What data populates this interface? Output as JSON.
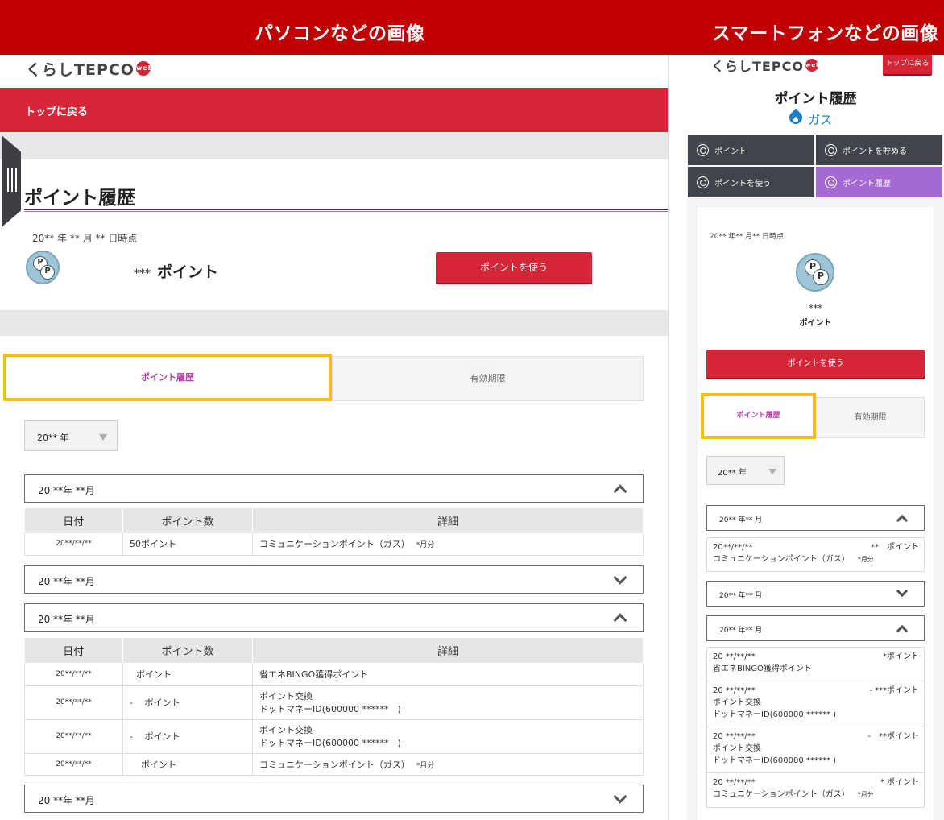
{
  "banner": {
    "pc_label": "パソコンなどの画像",
    "sp_label": "スマートフォンなどの画像"
  },
  "colors": {
    "brand_red": "#d62536",
    "banner_red": "#c00000",
    "accent_purple": "#b43fa8",
    "highlight_yellow": "#f4be1a",
    "menu_dark": "#40444b",
    "menu_active": "#a46ad2"
  },
  "brand": {
    "logo_text": "くらしTEPCO",
    "logo_badge": "web"
  },
  "pc": {
    "back_link": "トップに戻る",
    "page_title": "ポイント履歴",
    "as_of": "20** 年 ** 月 ** 日時点",
    "points_stars": "***",
    "points_label": "ポイント",
    "use_points_button": "ポイントを使う",
    "tabs": {
      "history": "ポイント履歴",
      "expiry": "有効期限"
    },
    "year_select": "20** 年",
    "table_headers": {
      "date": "日付",
      "points": "ポイント数",
      "detail": "詳細"
    },
    "months": [
      {
        "label": "20 **年 **月",
        "expanded": true,
        "rows": [
          {
            "date": "20**/**/**",
            "points": "50ポイント",
            "detail": "コミュニケーションポイント（ガス）",
            "unit": "*月分"
          }
        ]
      },
      {
        "label": "20 **年 **月",
        "expanded": false
      },
      {
        "label": "20 **年 **月",
        "expanded": true,
        "rows": [
          {
            "date": "20**/**/**",
            "points": "ポイント",
            "detail": "省エネBINGO獲得ポイント"
          },
          {
            "date": "20**/**/**",
            "points": "-　 ポイント",
            "detail": "ポイント交換",
            "detail2": "ドットマネーID(600000 ******　)"
          },
          {
            "date": "20**/**/**",
            "points": "-　 ポイント",
            "detail": "ポイント交換",
            "detail2": "ドットマネーID(600000 ******　)"
          },
          {
            "date": "20**/**/**",
            "points": "ポイント",
            "detail": "コミュニケーションポイント（ガス）",
            "unit": "*月分"
          }
        ]
      },
      {
        "label": "20 **年 **月",
        "expanded": false
      }
    ]
  },
  "sp": {
    "top_button": "トップに戻る",
    "page_title": "ポイント履歴",
    "service_label": "ガス",
    "menu": [
      {
        "label": "ポイント",
        "icon": "coin-icon"
      },
      {
        "label": "ポイントを貯める",
        "icon": "piggy-icon"
      },
      {
        "label": "ポイントを使う",
        "icon": "exchange-icon"
      },
      {
        "label": "ポイント履歴",
        "icon": "history-icon",
        "active": true
      }
    ],
    "as_of": "20** 年** 月** 日時点",
    "points_stars": "***",
    "points_label": "ポイント",
    "use_points_button": "ポイントを使う",
    "tabs": {
      "history": "ポイント履歴",
      "expiry": "有効期限"
    },
    "year_select": "20** 年",
    "months": [
      {
        "label": "20** 年** 月",
        "expanded": true,
        "rows": [
          {
            "date": "20**/**/**",
            "points": "**　ポイント",
            "detail": "コミュニケーションポイント（ガス）",
            "unit": "*月分"
          }
        ]
      },
      {
        "label": "20** 年** 月",
        "expanded": false
      },
      {
        "label": "20** 年** 月",
        "expanded": true,
        "rows": [
          {
            "date": "20 **/**/**",
            "points": "*ポイント",
            "detail": "省エネBINGO獲得ポイント"
          },
          {
            "date": "20 **/**/**",
            "points": "- ***ポイント",
            "detail": "ポイント交換",
            "detail2": "ドットマネーID(600000 ****** )"
          },
          {
            "date": "20 **/**/**",
            "points": "-　**ポイント",
            "detail": "ポイント交換",
            "detail2": "ドットマネーID(600000 ****** )"
          },
          {
            "date": "20 **/**/**",
            "points": "* ポイント",
            "detail": "コミュニケーションポイント（ガス）",
            "unit": "*月分"
          }
        ]
      }
    ]
  }
}
